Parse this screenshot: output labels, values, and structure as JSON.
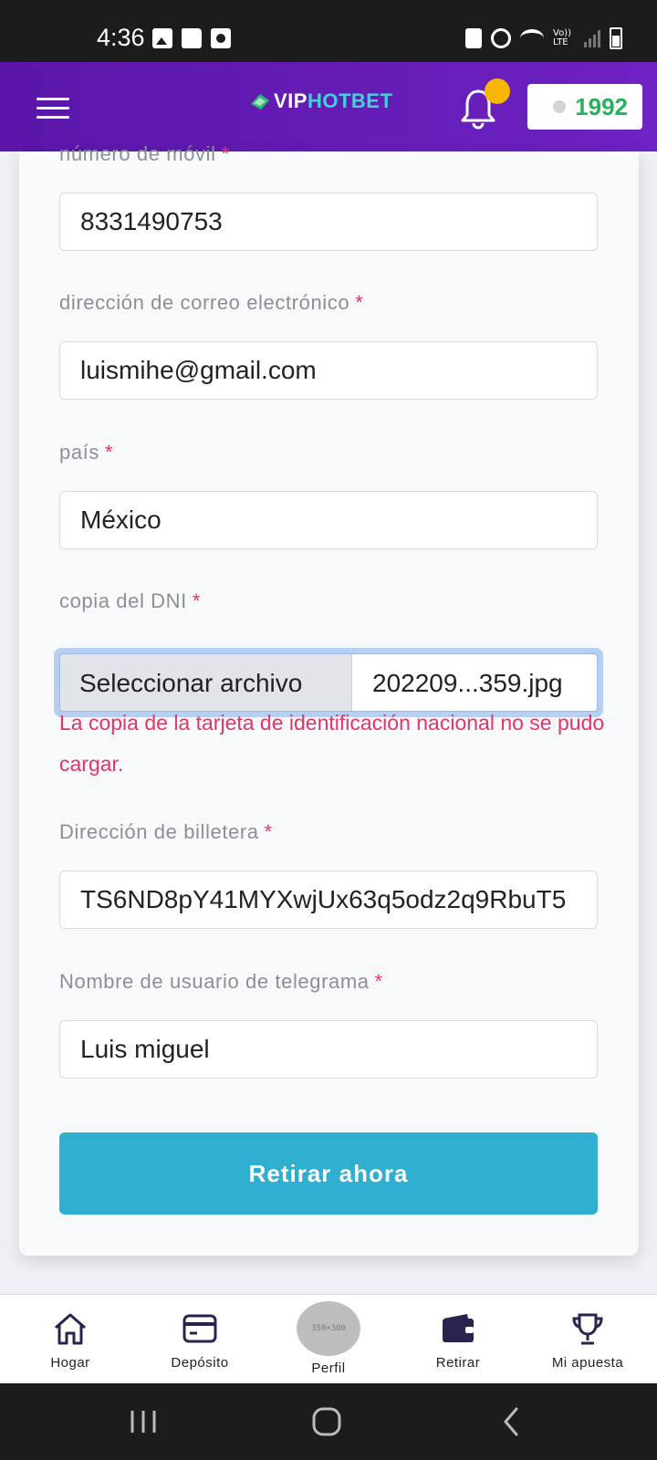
{
  "status_bar": {
    "time": "4:36",
    "left_icons": [
      "image-icon",
      "folder-icon",
      "camera-icon"
    ],
    "right_icons": [
      "battery-saver-icon",
      "alarm-icon",
      "wifi-icon",
      "volte-icon",
      "signal-icon",
      "battery-icon"
    ],
    "volte_label": "Vo)) LTE"
  },
  "header": {
    "logo_vip": "VIP",
    "logo_hotbet": "HOTBET",
    "balance": "1992",
    "brand_color": "#6a1fbf"
  },
  "form": {
    "fields": [
      {
        "label": "número de móvil",
        "required": "*",
        "value": "8331490753"
      },
      {
        "label": "dirección de correo electrónico",
        "required": "*",
        "value": "luismihe@gmail.com"
      },
      {
        "label": "país",
        "required": "*",
        "value": "México"
      },
      {
        "label": "copia del DNI",
        "required": "*"
      },
      {
        "label": "Dirección de billetera",
        "required": "*",
        "value": "TS6ND8pY41MYXwjUx63q5odz2q9RbuT5"
      },
      {
        "label": "Nombre de usuario de telegrama",
        "required": "*",
        "value": "Luis miguel"
      }
    ],
    "file": {
      "button_label": "Seleccionar archivo",
      "file_name": "202209...359.jpg"
    },
    "error": "La copia de la tarjeta de identificación nacional no se pudo cargar.",
    "submit_label": "Retirar ahora"
  },
  "bottom_nav": {
    "items": [
      {
        "label": "Hogar",
        "icon": "home-icon"
      },
      {
        "label": "Depósito",
        "icon": "card-icon"
      },
      {
        "label": "Perfil",
        "icon": "avatar",
        "avatar_text": "350×300"
      },
      {
        "label": "Retirar",
        "icon": "wallet-icon"
      },
      {
        "label": "Mi apuesta",
        "icon": "trophy-icon"
      }
    ]
  },
  "colors": {
    "accent": "#2eafd0",
    "error": "#e2366b",
    "balance": "#27b35a",
    "notification": "#f7b500"
  }
}
